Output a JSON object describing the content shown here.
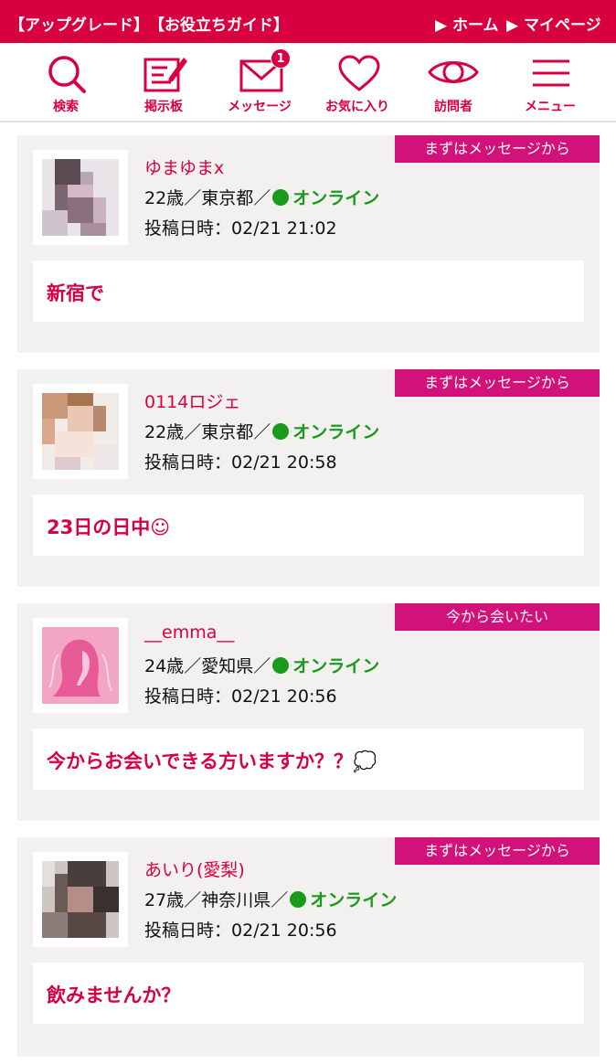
{
  "topbar": {
    "upgrade": "【アップグレード】",
    "guide": "【お役立ちガイド】",
    "home": "▶ ホーム",
    "mypage": "▶ マイページ"
  },
  "nav": {
    "search": "検索",
    "board": "掲示板",
    "message": "メッセージ",
    "message_badge": "1",
    "favorites": "お気に入り",
    "visitors": "訪問者",
    "menu": "メニュー"
  },
  "colors": {
    "brand": "#d9003f",
    "tag": "#d1127a",
    "online": "#1a9a1a",
    "card_bg": "#f2f1f0"
  },
  "posts": [
    {
      "tag": "まずはメッセージから",
      "name": "ゆまゆまx",
      "age": "22歳",
      "area": "東京都",
      "online": "オンライン",
      "posted_label": "投稿日時：",
      "posted": "02/21 21:02",
      "message": "新宿で"
    },
    {
      "tag": "まずはメッセージから",
      "name": "0114ロジェ",
      "age": "22歳",
      "area": "東京都",
      "online": "オンライン",
      "posted_label": "投稿日時：",
      "posted": "02/21 20:58",
      "message": "23日の日中☺"
    },
    {
      "tag": "今から会いたい",
      "name": "__emma__",
      "age": "24歳",
      "area": "愛知県",
      "online": "オンライン",
      "posted_label": "投稿日時：",
      "posted": "02/21 20:56",
      "message": "今からお会いできる方いますか？？💭"
    },
    {
      "tag": "まずはメッセージから",
      "name": "あいり(愛梨)",
      "age": "27歳",
      "area": "神奈川県",
      "online": "オンライン",
      "posted_label": "投稿日時：",
      "posted": "02/21 20:56",
      "message": "飲みませんか？"
    }
  ]
}
